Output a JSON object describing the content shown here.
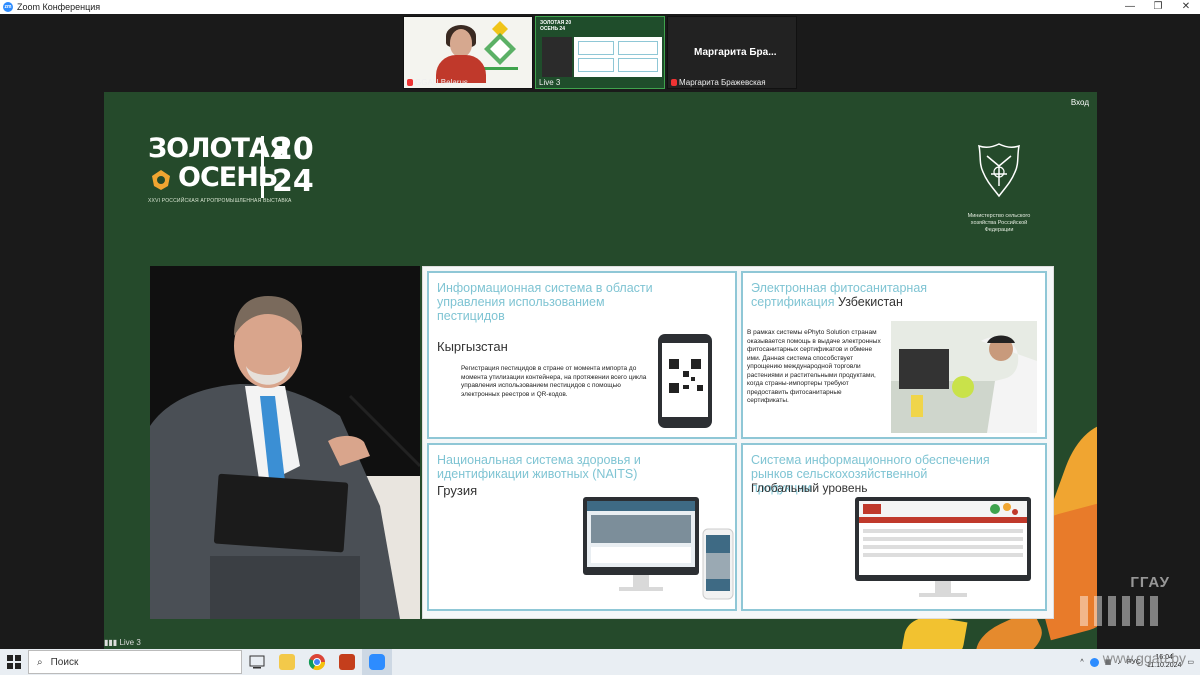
{
  "window": {
    "title": "Zoom Конференция",
    "minimize": "—",
    "maximize": "❐",
    "close": "✕"
  },
  "thumbnails": [
    {
      "label": "GGAU Belarus",
      "muted": true
    },
    {
      "label": "Live 3",
      "muted": false
    },
    {
      "label": "Маргарита Бражевская",
      "display_name": "Маргарита  Бра...",
      "muted": true
    }
  ],
  "shared_screen": {
    "exit_label": "Вход",
    "brand": {
      "line1": "ЗОЛОТАЯ",
      "line2": "ОСЕНЬ",
      "year_top": "20",
      "year_bottom": "24",
      "subtitle": "XXVI РОССИЙСКАЯ АГРОПРОМЫШЛЕННАЯ ВЫСТАВКА"
    },
    "ministry_caption": "Министерство сельского хозяйства Российской Федерации",
    "panels": [
      {
        "title": "Информационная система в области управления использованием пестицидов",
        "country": "Кыргызстан",
        "description": "Регистрация пестицидов в стране от момента импорта до момента утилизации контейнера, на протяжении всего цикла управления использованием пестицидов с помощью электронных реестров и QR-кодов."
      },
      {
        "title": "Электронная фитосанитарная сертификация",
        "country": "Узбекистан",
        "description": "В рамках системы ePhyto Solution странам оказывается помощь в выдаче электронных фитосанитарных сертификатов и обмене ими. Данная система способствует упрощению международной торговли растениями и растительными продуктами, когда страны-импортеры требуют предоставить фитосанитарные сертификаты."
      },
      {
        "title": "Национальная система здоровья и идентификации животных (NAITS)",
        "country": "Грузия",
        "description": ""
      },
      {
        "title": "Система информационного обеспечения рынков сельскохозяйственной продукции",
        "country": "Глобальный уровень",
        "description": ""
      }
    ],
    "live_tag": "Live 3",
    "watermark": "ГГАУ",
    "watermark_url": "www.ggau.by"
  },
  "taskbar": {
    "search_placeholder": "Поиск",
    "language": "РУС",
    "time": "16:04",
    "date": "11.10.2024",
    "apps": [
      "task-view",
      "file-explorer",
      "chrome",
      "powerpoint",
      "zoom"
    ]
  },
  "colors": {
    "slide_bg": "#254a2b",
    "panel_title": "#7fc4d3",
    "panel_border": "#8fc7d6",
    "accent_orange": "#f0a531",
    "zoom_blue": "#2d8cff"
  }
}
